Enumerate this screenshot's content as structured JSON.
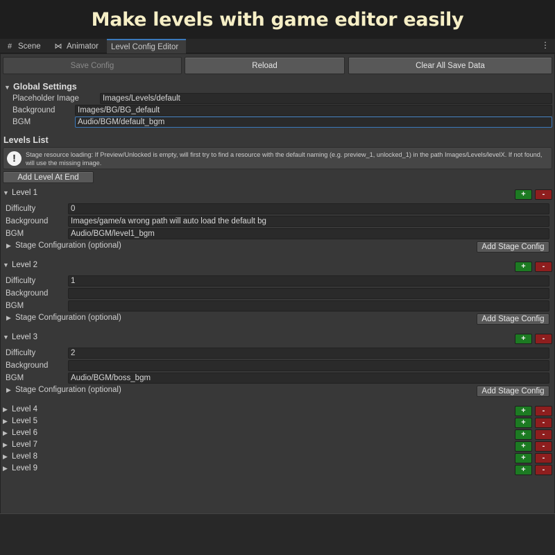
{
  "banner": {
    "title": "Make levels with game editor easily"
  },
  "tabs": [
    {
      "label": "Scene",
      "icon": "hash-icon"
    },
    {
      "label": "Animator",
      "icon": "animator-icon"
    },
    {
      "label": "Level Config Editor",
      "icon": ""
    }
  ],
  "kebab": "⋮",
  "toolbar": {
    "save": "Save Config",
    "reload": "Reload",
    "clear": "Clear All Save Data"
  },
  "global": {
    "title": "Global Settings",
    "placeholder_label": "Placeholder Image",
    "placeholder_value": "Images/Levels/default",
    "background_label": "Background",
    "background_value": "Images/BG/BG_default",
    "bgm_label": "BGM",
    "bgm_value": "Audio/BGM/default_bgm"
  },
  "levels_list": {
    "title": "Levels List",
    "help_text": "Stage resource loading: If Preview/Unlocked is empty, will first try to find a resource with the default naming (e.g. preview_1, unlocked_1) in the path Images/Levels/levelX. If not found, will use the missing image.",
    "add_button": "Add Level At End"
  },
  "labels": {
    "difficulty": "Difficulty",
    "background": "Background",
    "bgm": "BGM",
    "stage_config": "Stage Configuration (optional)",
    "add_stage": "Add Stage Config",
    "plus": "+",
    "minus": "-"
  },
  "levels": [
    {
      "name": "Level 1",
      "difficulty": "0",
      "background": "Images/game/a wrong path will auto load the default bg",
      "bgm": "Audio/BGM/level1_bgm"
    },
    {
      "name": "Level 2",
      "difficulty": "1",
      "background": "",
      "bgm": ""
    },
    {
      "name": "Level 3",
      "difficulty": "2",
      "background": "",
      "bgm": "Audio/BGM/boss_bgm"
    }
  ],
  "collapsed_levels": [
    "Level 4",
    "Level 5",
    "Level 6",
    "Level 7",
    "Level 8",
    "Level 9"
  ],
  "colors": {
    "plus": "#1c7a22",
    "minus": "#8e1e1e",
    "focus": "#3a79bb",
    "banner_text": "#f6efc6"
  }
}
